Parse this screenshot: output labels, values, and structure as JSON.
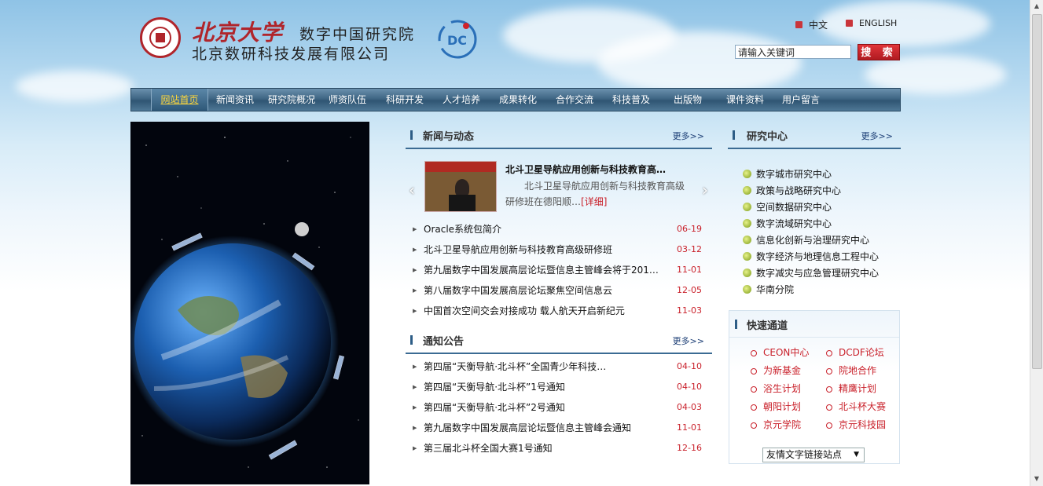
{
  "header": {
    "pku_name": "北京大学",
    "institute_name": "数字中国研究院",
    "company_name": "北京数研科技发展有限公司",
    "lang_cn": "中文",
    "lang_en": "ENGLISH",
    "search_placeholder": "请输入关键词",
    "search_button": "搜 索"
  },
  "nav": [
    {
      "label": "网站首页",
      "active": true
    },
    {
      "label": "新闻资讯"
    },
    {
      "label": "研究院概况"
    },
    {
      "label": "师资队伍"
    },
    {
      "label": "科研开发"
    },
    {
      "label": "人才培养"
    },
    {
      "label": "成果转化"
    },
    {
      "label": "合作交流"
    },
    {
      "label": "科技普及"
    },
    {
      "label": "出版物"
    },
    {
      "label": "课件资料"
    },
    {
      "label": "用户留言"
    }
  ],
  "news": {
    "title": "新闻与动态",
    "more": "更多>>",
    "featured": {
      "title": "北斗卫星导航应用创新与科技教育高…",
      "desc": "北斗卫星导航应用创新与科技教育高级研修班在德阳顺…",
      "detail": "[详细]"
    },
    "items": [
      {
        "text": "Oracle系统包简介",
        "date": "06-19"
      },
      {
        "text": "北斗卫星导航应用创新与科技教育高级研修班",
        "date": "03-12"
      },
      {
        "text": "第九届数字中国发展高层论坛暨信息主管峰会将于2012…",
        "date": "11-01"
      },
      {
        "text": "第八届数字中国发展高层论坛聚焦空间信息云",
        "date": "12-05"
      },
      {
        "text": "中国首次空间交会对接成功 载人航天开启新纪元",
        "date": "11-03"
      }
    ]
  },
  "notices": {
    "title": "通知公告",
    "more": "更多>>",
    "items": [
      {
        "text": "第四届“天衡导航·北斗杯”全国青少年科技…",
        "date": "04-10"
      },
      {
        "text": "第四届“天衡导航·北斗杯”1号通知",
        "date": "04-10"
      },
      {
        "text": "第四届“天衡导航·北斗杯”2号通知",
        "date": "04-03"
      },
      {
        "text": "第九届数字中国发展高层论坛暨信息主管峰会通知",
        "date": "11-01"
      },
      {
        "text": "第三届北斗杯全国大赛1号通知",
        "date": "12-16"
      }
    ]
  },
  "research": {
    "title": "研究中心",
    "more": "更多>>",
    "items": [
      "数字城市研究中心",
      "政策与战略研究中心",
      "空间数据研究中心",
      "数字流域研究中心",
      "信息化创新与治理研究中心",
      "数字经济与地理信息工程中心",
      "数字减灾与应急管理研究中心",
      "华南分院"
    ]
  },
  "quick": {
    "title": "快速通道",
    "items": [
      "CEON中心",
      "DCDF论坛",
      "为新基金",
      "院地合作",
      "浴生计划",
      "精鹰计划",
      "朝阳计划",
      "北斗杯大赛",
      "京元学院",
      "京元科技园"
    ],
    "select_label": "友情文字链接站点"
  },
  "colors": {
    "accent_red": "#c9202a",
    "nav_blue": "#3f6684",
    "nav_active_text": "#ffd83a"
  }
}
